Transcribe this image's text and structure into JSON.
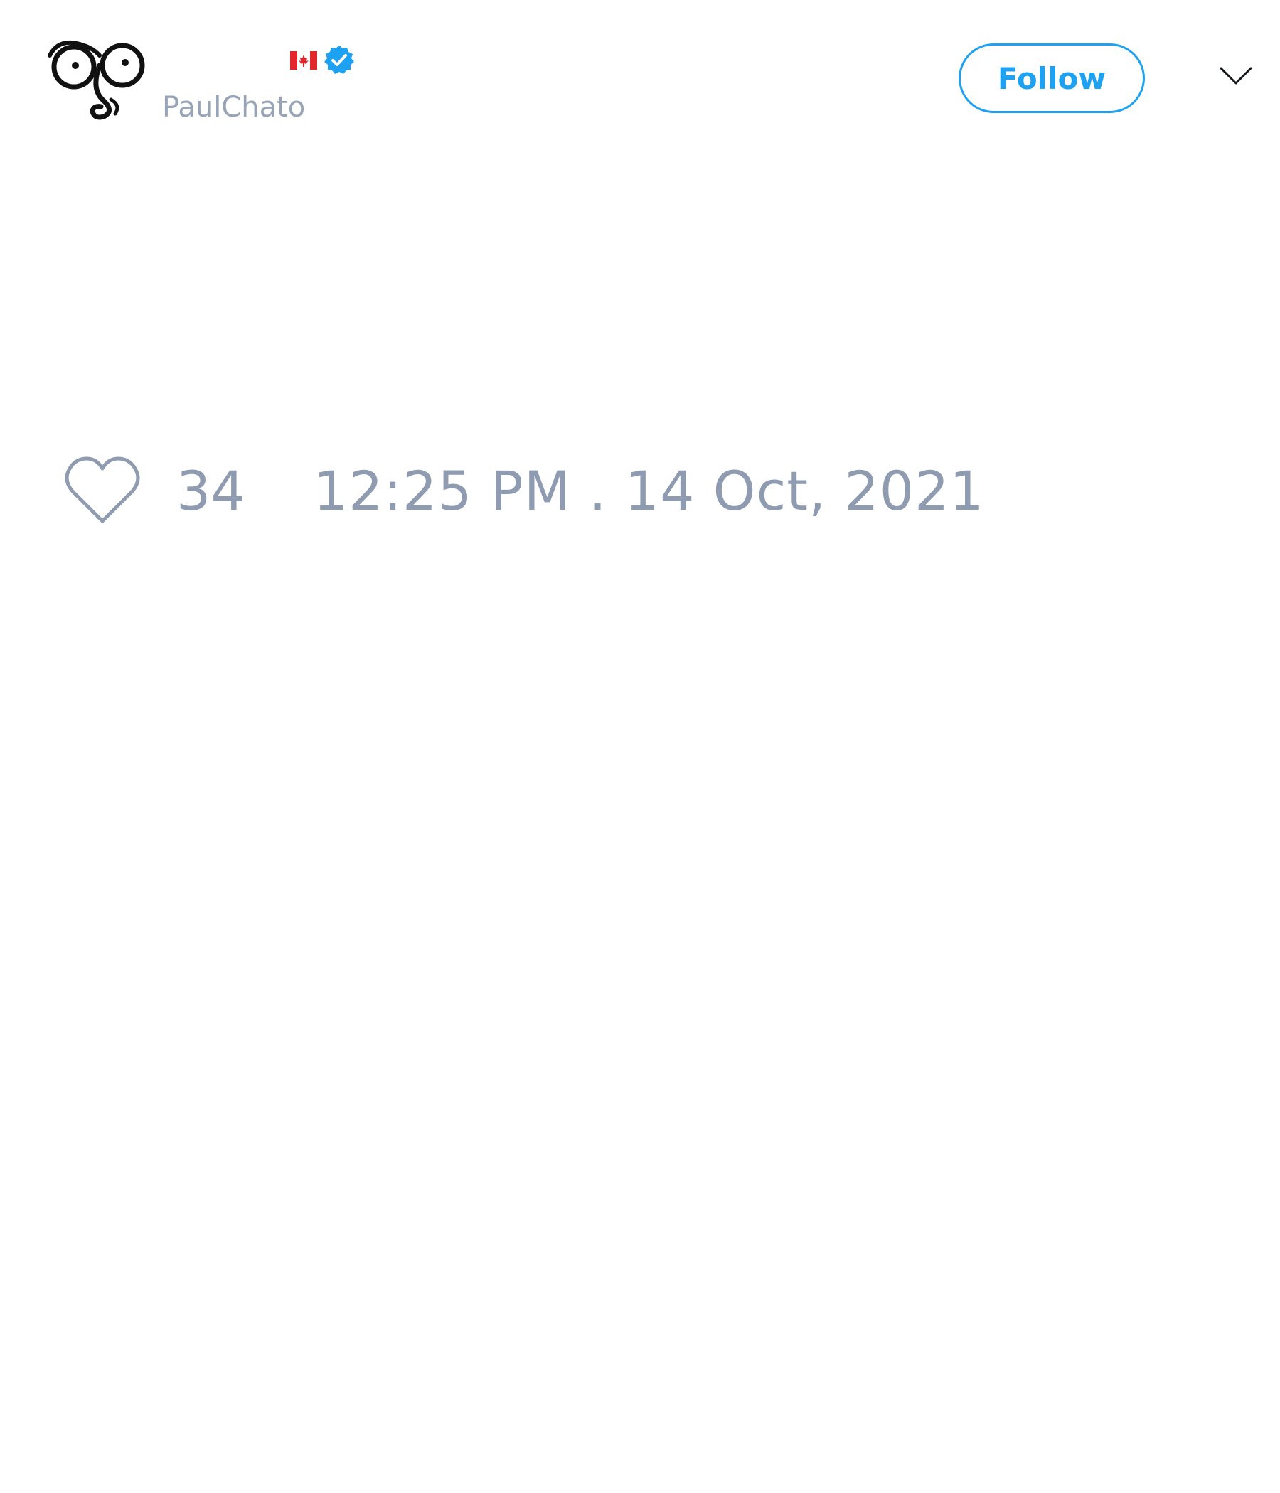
{
  "author": {
    "display_name": "",
    "handle": "PaulChato",
    "flag_icon": "canada-flag-icon",
    "verified_icon": "verified-badge-icon",
    "verified_color": "#1da1f2"
  },
  "actions": {
    "follow_label": "Follow",
    "menu_icon": "chevron-down-icon"
  },
  "footer": {
    "like_icon": "heart-outline-icon",
    "like_count": "34",
    "timestamp": "12:25 PM . 14 Oct, 2021"
  },
  "colors": {
    "accent": "#1da1f2",
    "muted_text": "#8e9bb0",
    "background": "#ffffff"
  }
}
